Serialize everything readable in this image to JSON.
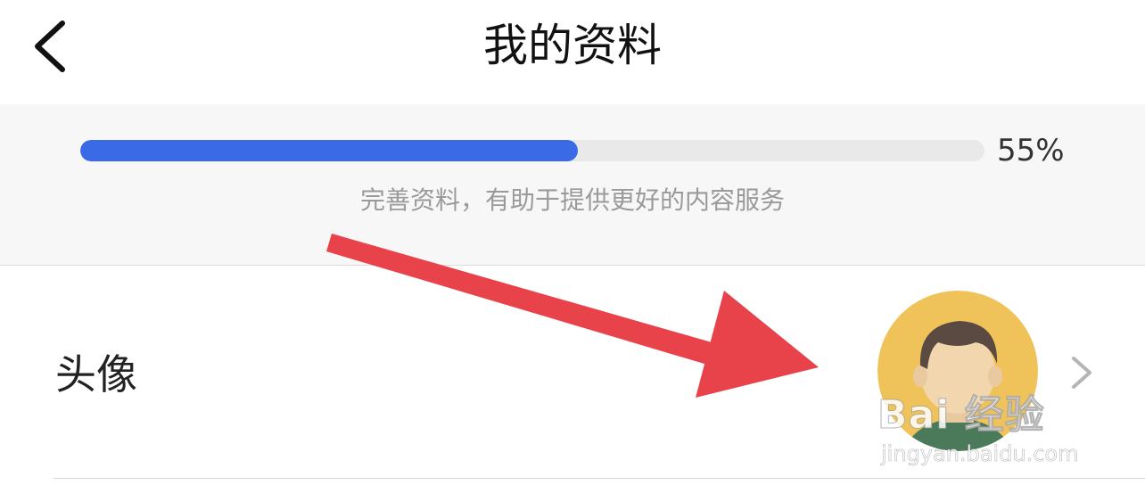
{
  "header": {
    "title": "我的资料",
    "back_icon": "chevron-left-icon"
  },
  "profile_progress": {
    "percent_value": 55,
    "percent_label": "55%",
    "hint": "完善资料，有助于提供更好的内容服务",
    "fill_color": "#3a6ae5",
    "track_color": "#e9e9e9"
  },
  "avatar_row": {
    "label": "头像",
    "avatar_icon": "user-avatar",
    "chevron_icon": "chevron-right-icon"
  },
  "annotation": {
    "arrow_color": "#e8434b"
  },
  "watermark": {
    "brand": "Bai 经验",
    "url": "jingyan.baidu.com"
  }
}
